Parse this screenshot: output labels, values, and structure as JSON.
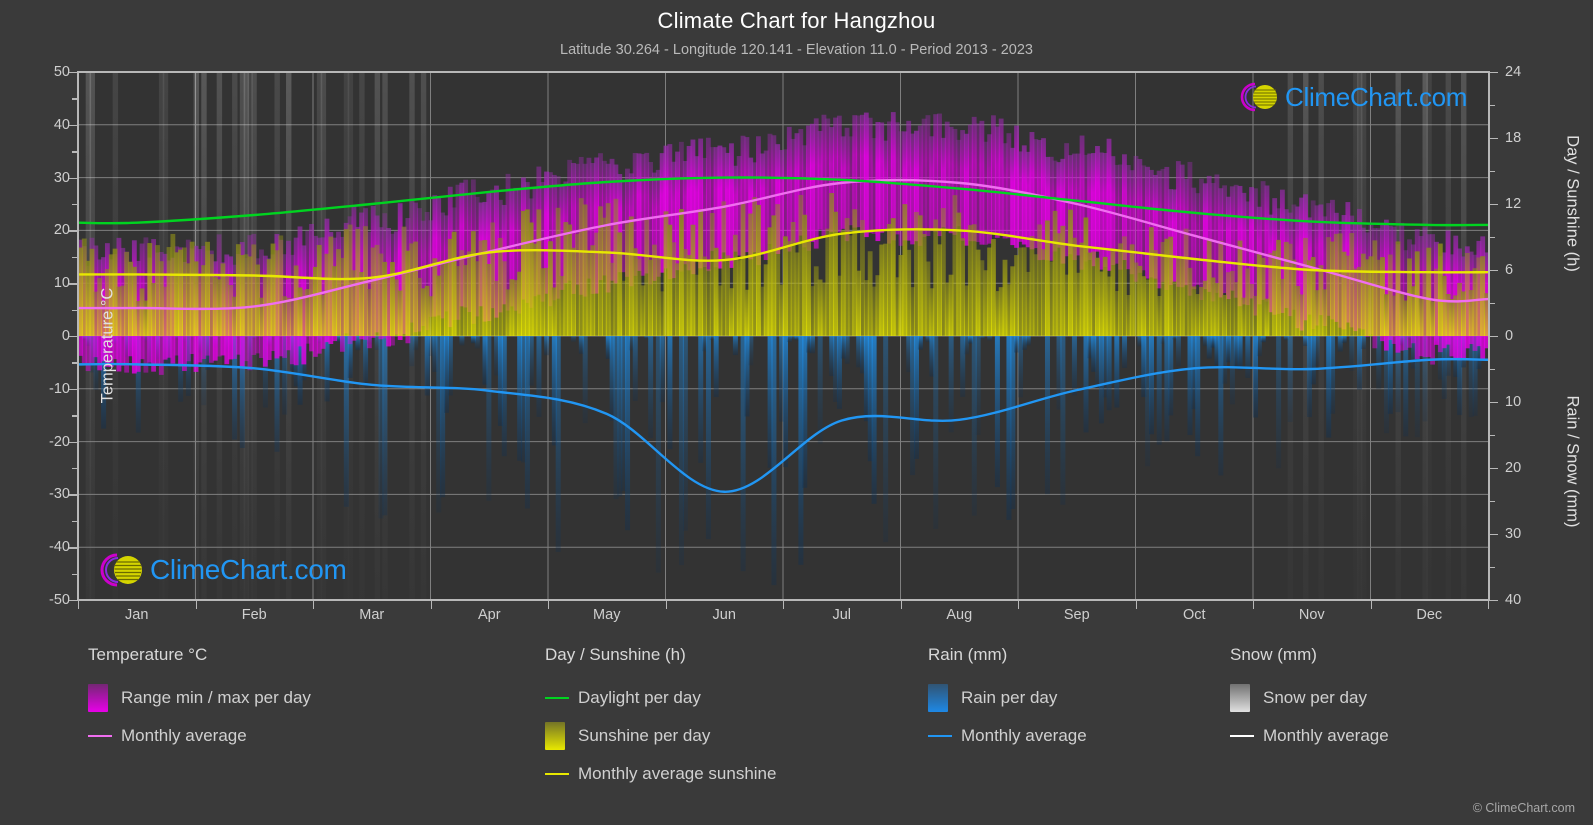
{
  "header": {
    "title": "Climate Chart for Hangzhou",
    "subtitle": "Latitude 30.264 - Longitude 120.141 - Elevation 11.0 - Period 2013 - 2023"
  },
  "watermark": {
    "text": "ClimeChart.com",
    "logo_arc_color": "#cc00cc",
    "logo_sphere_color": "#d4d400",
    "text_color": "#2196f3"
  },
  "footer": {
    "copyright": "© ClimeChart.com"
  },
  "axes": {
    "left": {
      "label": "Temperature °C",
      "ticks": [
        "50",
        "40",
        "30",
        "20",
        "10",
        "0",
        "-10",
        "-20",
        "-30",
        "-40",
        "-50"
      ],
      "min": -50,
      "max": 50
    },
    "right_top": {
      "label": "Day / Sunshine (h)",
      "ticks": [
        "24",
        "18",
        "12",
        "6",
        "0"
      ],
      "min": 0,
      "max": 24
    },
    "right_bottom": {
      "label": "Rain / Snow (mm)",
      "ticks": [
        "0",
        "10",
        "20",
        "30",
        "40"
      ],
      "min": 0,
      "max": 40
    },
    "x": {
      "ticks": [
        "Jan",
        "Feb",
        "Mar",
        "Apr",
        "May",
        "Jun",
        "Jul",
        "Aug",
        "Sep",
        "Oct",
        "Nov",
        "Dec"
      ]
    }
  },
  "legend": {
    "columns": [
      {
        "title": "Temperature °C",
        "items": [
          {
            "label": "Range min / max per day",
            "type": "swatch",
            "color": "#e800e8"
          },
          {
            "label": "Monthly average",
            "type": "line",
            "color": "#f06ef0"
          }
        ]
      },
      {
        "title": "Day / Sunshine (h)",
        "items": [
          {
            "label": "Daylight per day",
            "type": "line",
            "color": "#00d420"
          },
          {
            "label": "Sunshine per day",
            "type": "swatch",
            "color": "#e8e800"
          },
          {
            "label": "Monthly average sunshine",
            "type": "line",
            "color": "#e8e800"
          }
        ]
      },
      {
        "title": "Rain (mm)",
        "items": [
          {
            "label": "Rain per day",
            "type": "swatch",
            "color": "#1e88e5"
          },
          {
            "label": "Monthly average",
            "type": "line",
            "color": "#2196f3"
          }
        ]
      },
      {
        "title": "Snow (mm)",
        "items": [
          {
            "label": "Snow per day",
            "type": "swatch",
            "color": "#e0e0e0"
          },
          {
            "label": "Monthly average",
            "type": "line",
            "color": "#ffffff"
          }
        ]
      }
    ]
  },
  "chart_data": {
    "type": "line",
    "title": "Climate Chart for Hangzhou",
    "subtitle": "Latitude 30.264 - Longitude 120.141 - Elevation 11.0 - Period 2013 - 2023",
    "xlabel": "",
    "ylabel": "Temperature °C",
    "ylabel_right_top": "Day / Sunshine (h)",
    "ylabel_right_bottom": "Rain / Snow (mm)",
    "ylim": [
      -50,
      50
    ],
    "ylim_right_top": [
      0,
      24
    ],
    "ylim_right_bottom": [
      0,
      40
    ],
    "grid": true,
    "legend_position": "below",
    "categories": [
      "Jan",
      "Feb",
      "Mar",
      "Apr",
      "May",
      "Jun",
      "Jul",
      "Aug",
      "Sep",
      "Oct",
      "Nov",
      "Dec"
    ],
    "series": [
      {
        "name": "Monthly average temperature",
        "unit": "°C",
        "axis": "left",
        "color": "#f06ef0",
        "values": [
          5.3,
          5.6,
          10.5,
          16.0,
          21.0,
          24.5,
          29.0,
          29.0,
          25.0,
          19.0,
          13.0,
          7.0
        ]
      },
      {
        "name": "Daylight per day",
        "unit": "h",
        "axis": "right_top",
        "color": "#00d420",
        "values": [
          10.3,
          11.0,
          12.0,
          13.1,
          14.0,
          14.4,
          14.2,
          13.4,
          12.3,
          11.2,
          10.4,
          10.1
        ]
      },
      {
        "name": "Monthly average sunshine",
        "unit": "h",
        "axis": "right_top",
        "color": "#e8e800",
        "values": [
          5.6,
          5.5,
          5.3,
          7.6,
          7.6,
          6.9,
          9.3,
          9.6,
          8.2,
          7.0,
          6.0,
          5.8
        ]
      },
      {
        "name": "Monthly average rain",
        "unit": "mm",
        "axis": "right_bottom",
        "color": "#2196f3",
        "values": [
          4.3,
          4.9,
          7.4,
          8.3,
          11.8,
          23.6,
          12.8,
          12.7,
          8.2,
          4.9,
          5.0,
          3.6
        ]
      },
      {
        "name": "Monthly average snow",
        "unit": "mm",
        "axis": "right_bottom",
        "color": "#ffffff",
        "values": [
          0,
          0,
          0,
          0,
          0,
          0,
          0,
          0,
          0,
          0,
          0,
          0
        ]
      }
    ],
    "daily_bands": [
      {
        "name": "Temperature range min / max per day",
        "color": "#e800e8",
        "monthly_min": [
          1.0,
          1.5,
          6.0,
          11.0,
          16.5,
          21.0,
          25.5,
          25.5,
          21.0,
          15.0,
          9.0,
          3.0
        ],
        "monthly_max": [
          9.5,
          10.0,
          15.5,
          21.0,
          25.5,
          28.5,
          33.5,
          33.5,
          29.0,
          23.5,
          17.5,
          11.5
        ]
      },
      {
        "name": "Sunshine per day",
        "color": "#e8e800",
        "monthly_max": [
          8.5,
          8.8,
          9.5,
          11.0,
          11.5,
          11.5,
          12.0,
          11.8,
          10.5,
          9.8,
          9.0,
          8.5
        ]
      },
      {
        "name": "Rain per day",
        "color": "#1e88e5",
        "monthly_max": [
          18,
          20,
          28,
          30,
          38,
          40,
          34,
          32,
          30,
          22,
          20,
          16
        ]
      },
      {
        "name": "Snow per day",
        "color": "#e0e0e0",
        "monthly_max": [
          6,
          5,
          1,
          0,
          0,
          0,
          0,
          0,
          0,
          0,
          1,
          3
        ]
      }
    ]
  },
  "colors": {
    "page_background": "#3a3a3a",
    "plot_background": "#333333",
    "grid": "#8d8d8d",
    "frame": "#b8b8b8",
    "text": "#cfcfcf"
  }
}
